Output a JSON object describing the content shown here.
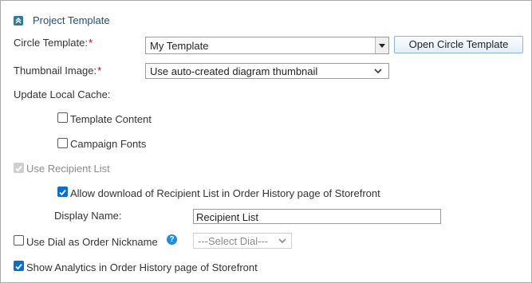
{
  "section": {
    "title": "Project Template",
    "icon": "collapse-chevron-up-icon"
  },
  "circle_template": {
    "label": "Circle Template:",
    "required_mark": "*",
    "value": "My Template",
    "open_button_label": "Open Circle Template"
  },
  "thumbnail_image": {
    "label": "Thumbnail Image:",
    "required_mark": "*",
    "selected": "Use auto-created diagram thumbnail"
  },
  "update_local_cache": {
    "label": "Update Local Cache:",
    "options": [
      {
        "label": "Template Content",
        "checked": false
      },
      {
        "label": "Campaign Fonts",
        "checked": false
      }
    ]
  },
  "use_recipient_list": {
    "label": "Use Recipient List",
    "checked": true,
    "disabled": true
  },
  "allow_download": {
    "label": "Allow download of Recipient List in Order History page of Storefront",
    "checked": true
  },
  "display_name": {
    "label": "Display Name:",
    "value": "Recipient List"
  },
  "use_dial": {
    "label": "Use Dial as Order Nickname",
    "checked": false,
    "help_icon": "?",
    "select_placeholder": "---Select Dial---"
  },
  "show_analytics": {
    "label": "Show Analytics in Order History page of Storefront",
    "checked": true
  },
  "colors": {
    "accent": "#0a6ed1",
    "title": "#1f4e79",
    "required": "#d00000",
    "icon_teal": "#2e7d96",
    "help": "#1e8fd9"
  }
}
